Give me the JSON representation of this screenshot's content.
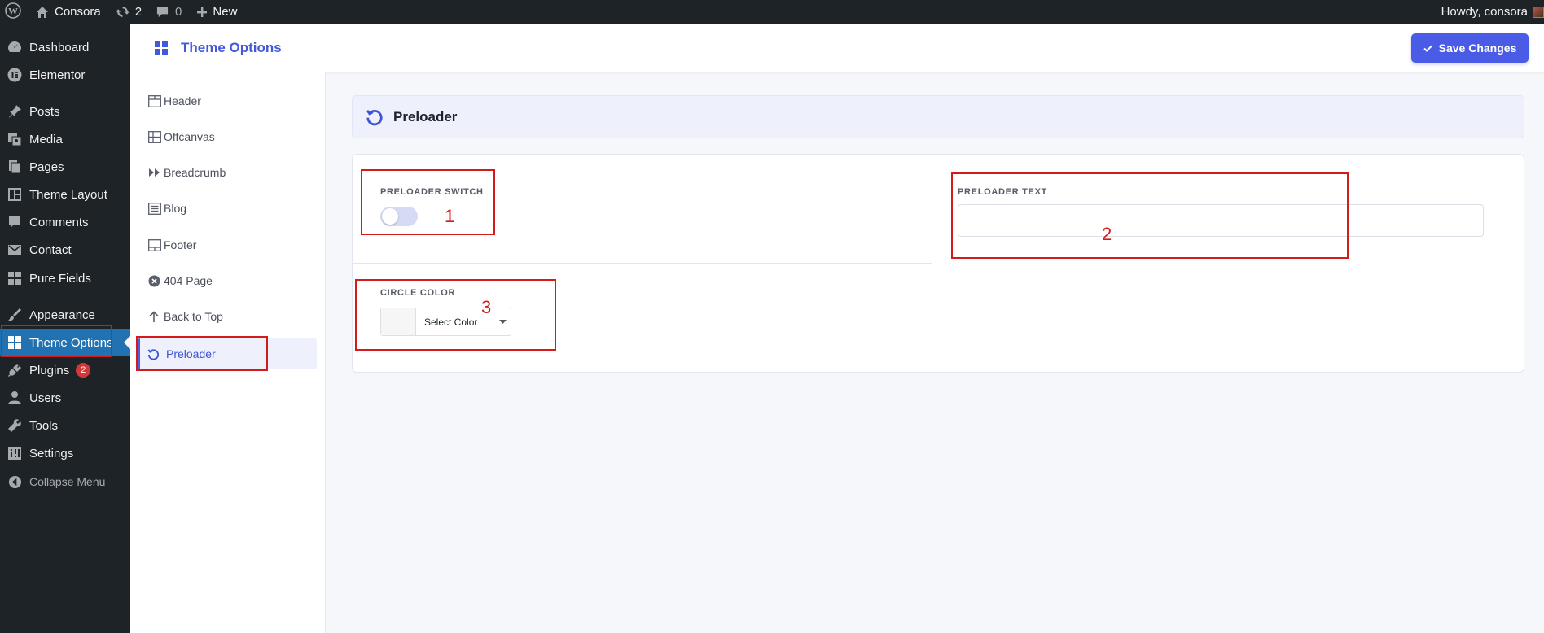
{
  "adminbar": {
    "site_name": "Consora",
    "updates_count": "2",
    "comments_count": "0",
    "new_label": "New",
    "greeting": "Howdy, consora"
  },
  "menu": {
    "items": [
      {
        "label": "Dashboard",
        "icon": "dashboard-icon"
      },
      {
        "label": "Elementor",
        "icon": "elementor-icon"
      },
      {
        "label": "Posts",
        "icon": "pin-icon"
      },
      {
        "label": "Media",
        "icon": "media-icon"
      },
      {
        "label": "Pages",
        "icon": "pages-icon"
      },
      {
        "label": "Theme Layout",
        "icon": "layout-icon"
      },
      {
        "label": "Comments",
        "icon": "comments-icon"
      },
      {
        "label": "Contact",
        "icon": "mail-icon"
      },
      {
        "label": "Pure Fields",
        "icon": "grid-icon"
      },
      {
        "label": "Appearance",
        "icon": "brush-icon"
      },
      {
        "label": "Theme Options",
        "icon": "grid-icon"
      },
      {
        "label": "Plugins",
        "icon": "plugins-icon",
        "badge": "2"
      },
      {
        "label": "Users",
        "icon": "users-icon"
      },
      {
        "label": "Tools",
        "icon": "wrench-icon"
      },
      {
        "label": "Settings",
        "icon": "settings-icon"
      },
      {
        "label": "Collapse Menu",
        "icon": "collapse-icon"
      }
    ]
  },
  "header": {
    "title": "Theme Options",
    "save_label": "Save Changes"
  },
  "options_nav": {
    "items": [
      {
        "label": "Header"
      },
      {
        "label": "Offcanvas"
      },
      {
        "label": "Breadcrumb"
      },
      {
        "label": "Blog"
      },
      {
        "label": "Footer"
      },
      {
        "label": "404 Page"
      },
      {
        "label": "Back to Top"
      },
      {
        "label": "Preloader"
      }
    ]
  },
  "section": {
    "title": "Preloader",
    "switch_label": "PRELOADER SWITCH",
    "switch_on": false,
    "text_label": "PRELOADER TEXT",
    "text_value": "",
    "color_label": "CIRCLE COLOR",
    "color_button": "Select Color"
  },
  "annotations": [
    "1",
    "2",
    "3"
  ],
  "colors": {
    "accent": "#4a5ce6",
    "admin_bg": "#1d2327",
    "active_menu": "#2271b1",
    "annotation": "#d41b1b"
  }
}
